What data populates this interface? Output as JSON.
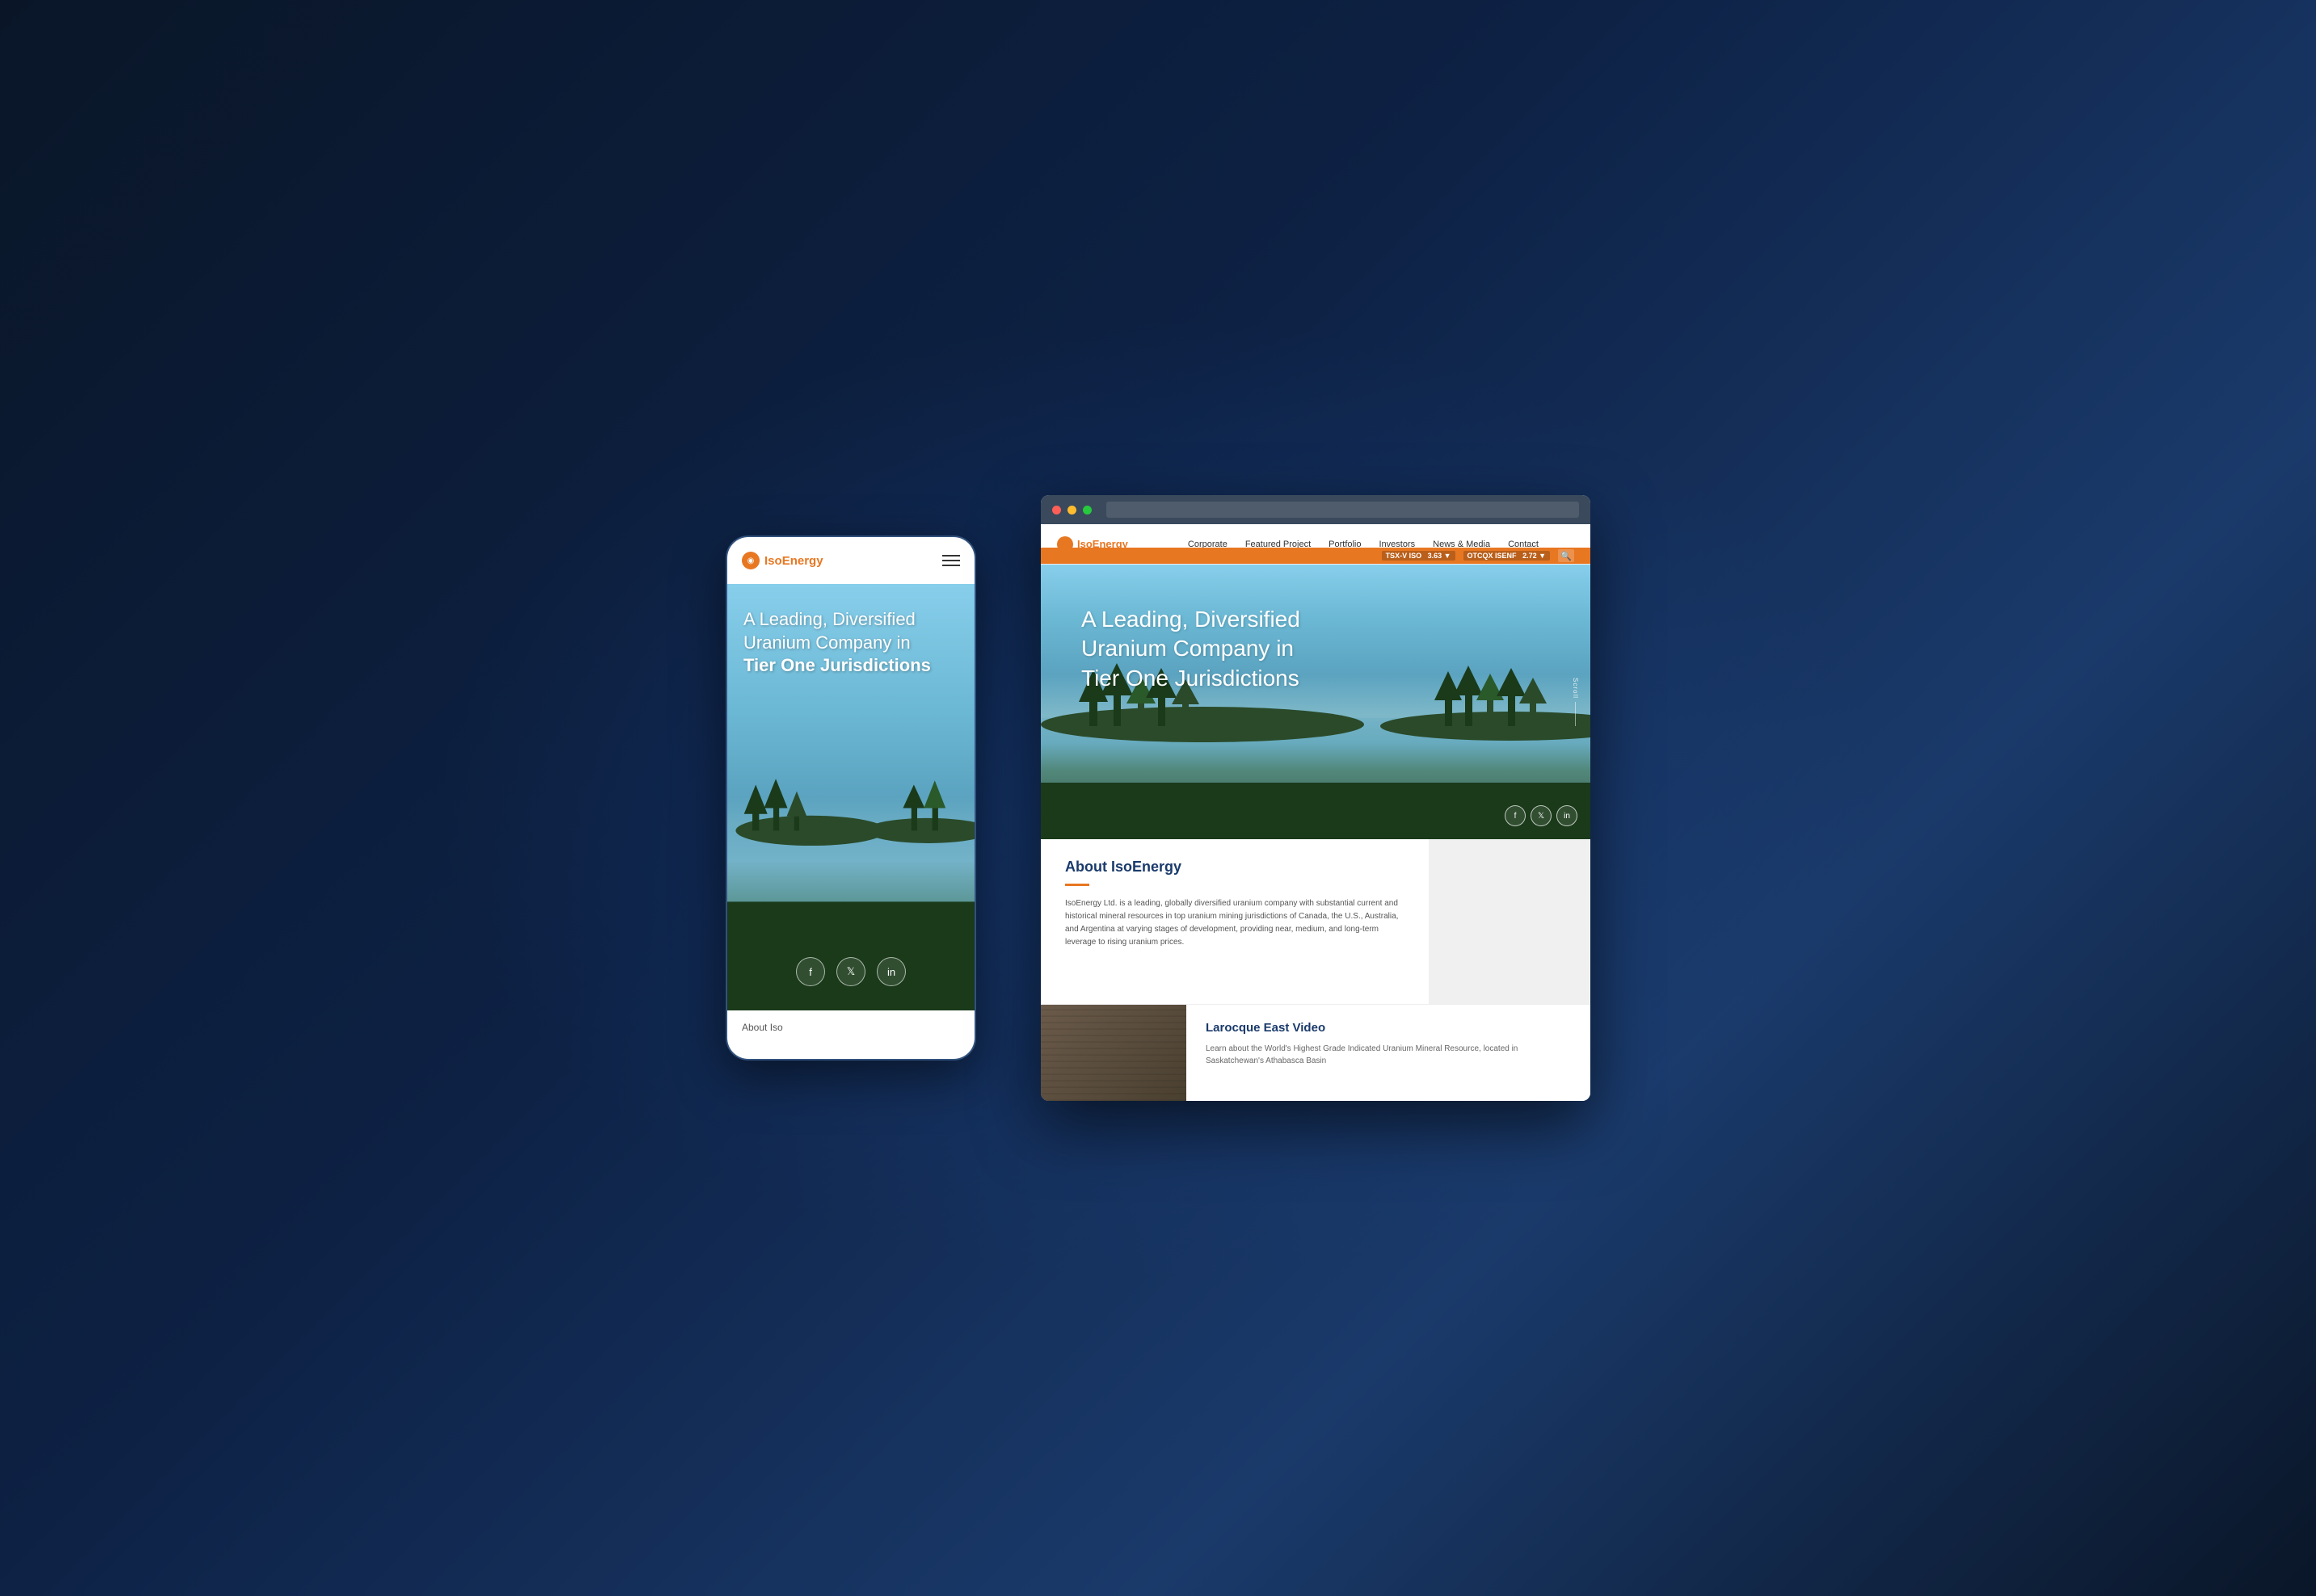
{
  "background": {
    "color_start": "#0a1628",
    "color_end": "#1a3a6b"
  },
  "mobile": {
    "logo_text_plain": "Iso",
    "logo_text_bold": "Energy",
    "hamburger_label": "Menu",
    "hero_headline_line1": "A Leading, Diversified",
    "hero_headline_line2": "Uranium Company in",
    "hero_headline_line3": "Tier One Jurisdictions",
    "social_facebook": "f",
    "social_twitter": "𝕏",
    "social_linkedin": "in",
    "about_label": "About Iso"
  },
  "desktop": {
    "logo_text_plain": "Iso",
    "logo_text_bold": "Energy",
    "nav": {
      "corporate": "Corporate",
      "featured_project": "Featured Project",
      "portfolio": "Portfolio",
      "investors": "Investors",
      "news_media": "News & Media",
      "contact": "Contact"
    },
    "ticker": {
      "tsx_label": "TSX-V  ISO",
      "tsx_value": "3.63 ▼",
      "otcqx_label": "OTCQX  ISENF",
      "otcqx_value": "2.72 ▼"
    },
    "hero": {
      "headline_line1": "A Leading, Diversified",
      "headline_line2": "Uranium Company in",
      "headline_line3": "Tier One Jurisdictions",
      "scroll_text": "Scroll"
    },
    "social_facebook": "f",
    "social_twitter": "𝕏",
    "social_linkedin": "in",
    "about": {
      "title": "About IsoEnergy",
      "body": "IsoEnergy Ltd. is a leading, globally diversified uranium company with substantial current and historical mineral resources in top uranium mining jurisdictions of Canada, the U.S., Australia, and Argentina at varying stages of development, providing near, medium, and long-term leverage to rising uranium prices."
    },
    "video": {
      "title": "Larocque East Video",
      "description": "Learn about the World's Highest Grade Indicated Uranium Mineral Resource, located in Saskatchewan's Athabasca Basin"
    }
  }
}
